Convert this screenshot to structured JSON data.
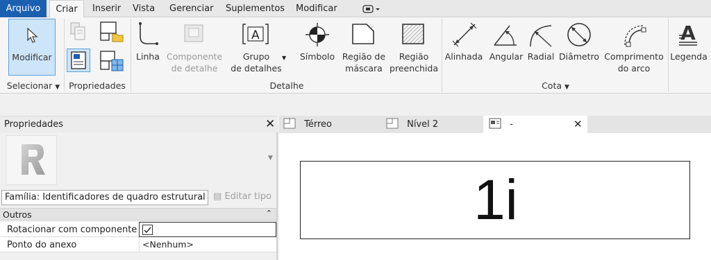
{
  "menubar": {
    "file": "Arquivo",
    "tabs": [
      "Criar",
      "Inserir",
      "Vista",
      "Gerenciar",
      "Suplementos",
      "Modificar"
    ]
  },
  "ribbon": {
    "select": {
      "modify": "Modificar",
      "footer": "Selecionar"
    },
    "properties": {
      "footer": "Propriedades"
    },
    "detail": {
      "line": "Linha",
      "component_l1": "Componente",
      "component_l2": "de detalhe",
      "group_l1": "Grupo",
      "group_l2": "de detalhes",
      "symbol": "Símbolo",
      "mask_l1": "Região de",
      "mask_l2": "máscara",
      "filled_l1": "Região",
      "filled_l2": "preenchida",
      "footer": "Detalhe"
    },
    "dimension": {
      "aligned": "Alinhada",
      "angular": "Angular",
      "radial": "Radial",
      "diameter": "Diâmetro",
      "arc_l1": "Comprimento",
      "arc_l2": "do arco",
      "footer": "Cota"
    },
    "text": {
      "legend": "Legenda"
    }
  },
  "properties_panel": {
    "title": "Propriedades",
    "type_selector": "Família: Identificadores de quadro estrutural",
    "edit_type": "Editar tipo",
    "category": "Outros",
    "rows": [
      {
        "label": "Rotacionar com componente",
        "checked": true
      },
      {
        "label": "Ponto do anexo",
        "value": "<Nenhum>"
      }
    ]
  },
  "view_tabs": [
    {
      "label": "Térreo"
    },
    {
      "label": "Nível 2"
    },
    {
      "label": "-",
      "active": true
    }
  ],
  "canvas": {
    "tag_text": "1i"
  },
  "colors": {
    "file_tab": "#1b5fb0",
    "selected_bg": "#cde5f8",
    "selected_border": "#5aa0dc"
  }
}
